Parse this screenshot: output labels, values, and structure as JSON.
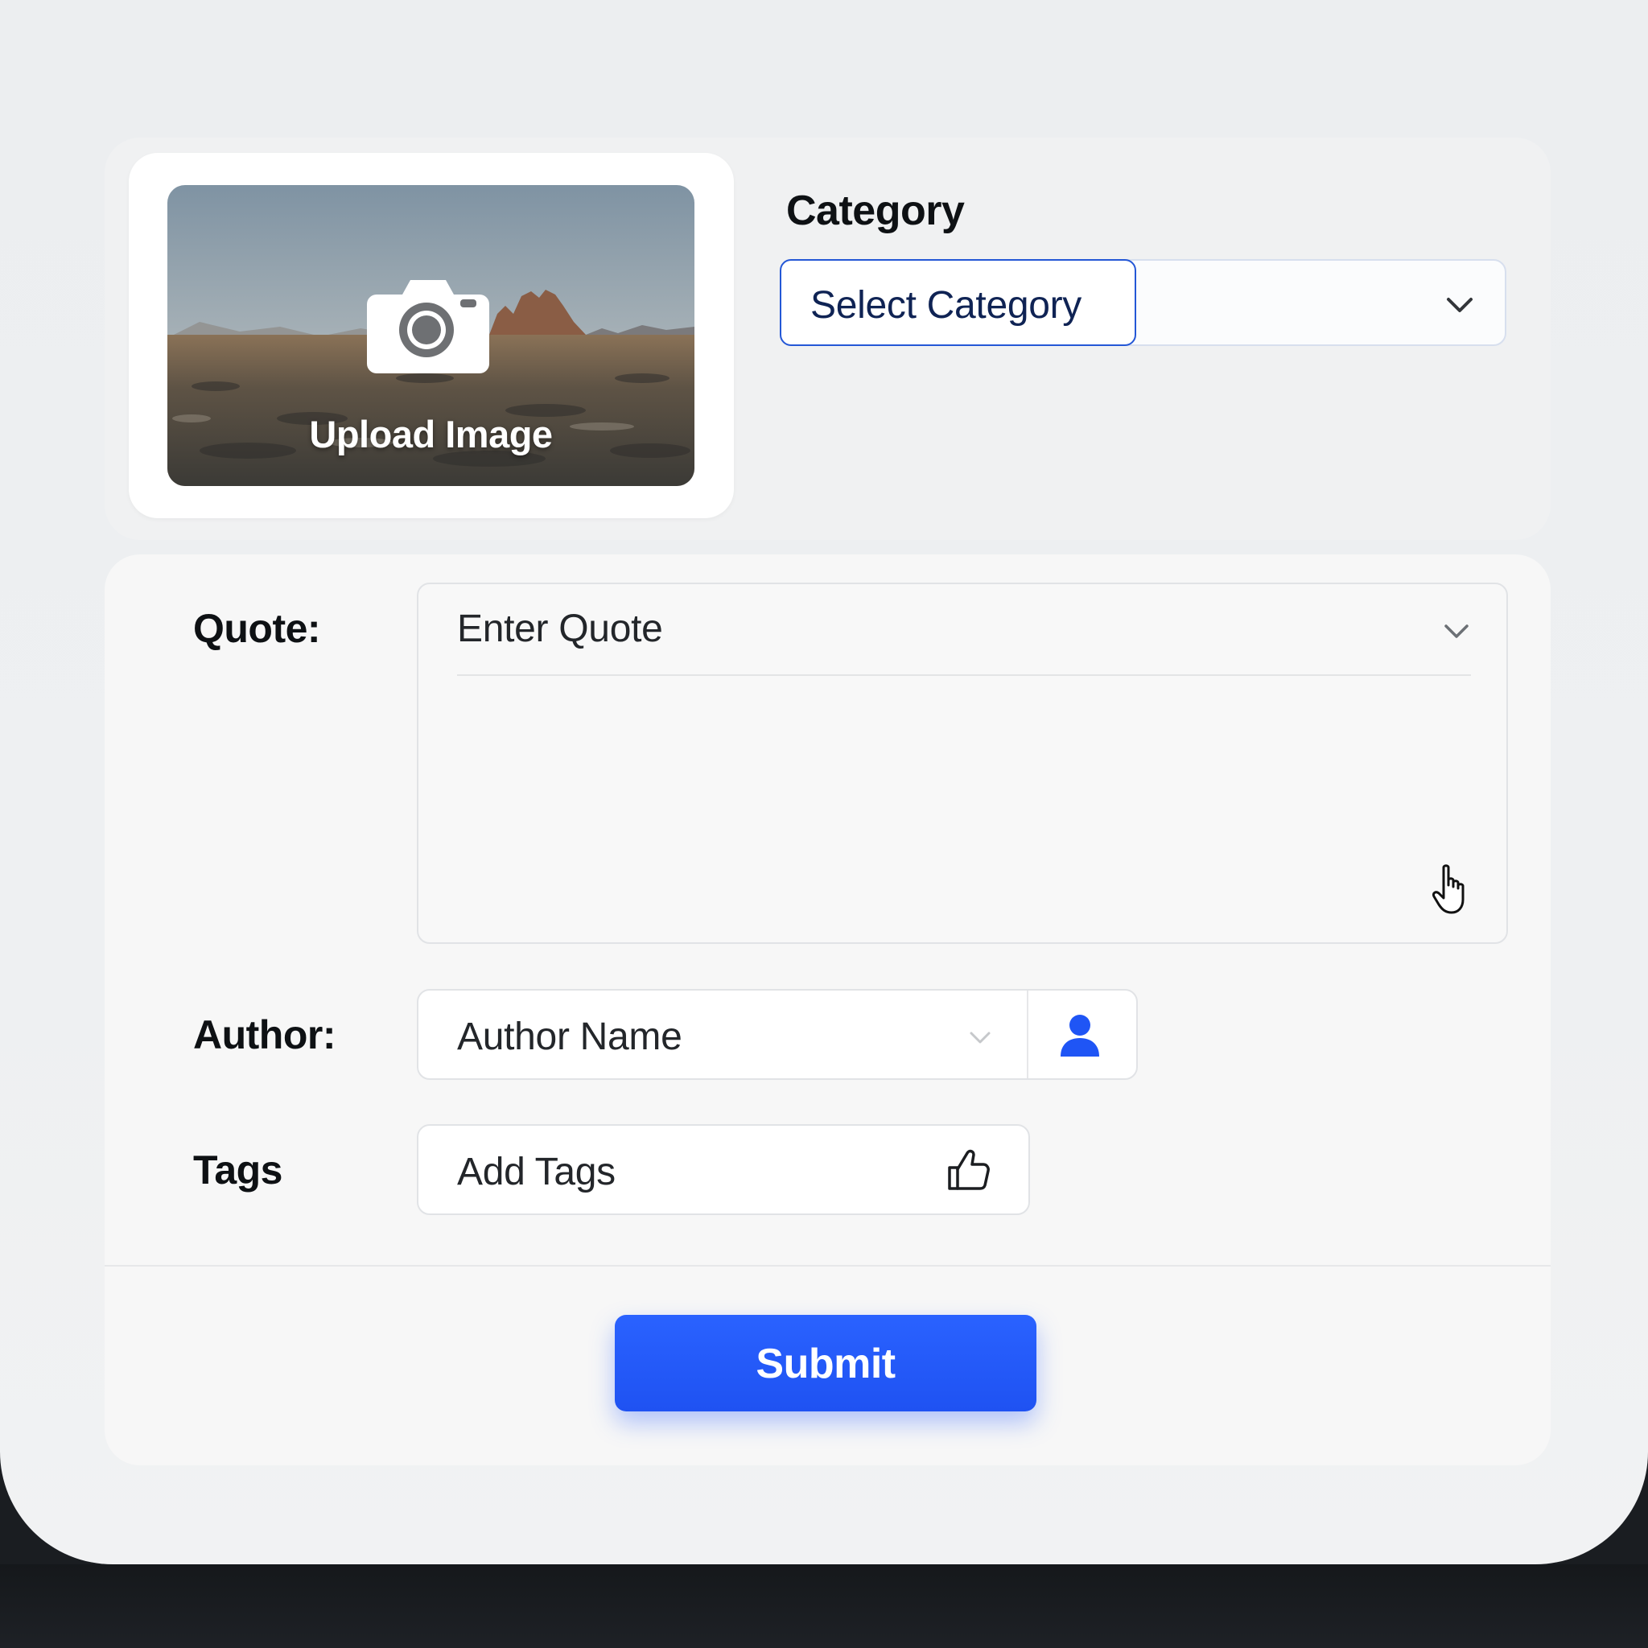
{
  "upload": {
    "label": "Upload Image",
    "icon": "camera-icon"
  },
  "category": {
    "label": "Category",
    "selected": "Select Category",
    "icon": "chevron-down-icon"
  },
  "quote": {
    "label": "Quote:",
    "placeholder": "Enter Quote",
    "value": ""
  },
  "author": {
    "label": "Author:",
    "placeholder": "Author Name",
    "icon": "person-icon"
  },
  "tags": {
    "label": "Tags",
    "placeholder": "Add Tags",
    "icon": "thumbs-up-icon"
  },
  "submit": {
    "label": "Submit"
  },
  "colors": {
    "accent": "#1f55f5",
    "select_border": "#2457d6",
    "select_text": "#0f2354",
    "background": "#eef0f2"
  }
}
